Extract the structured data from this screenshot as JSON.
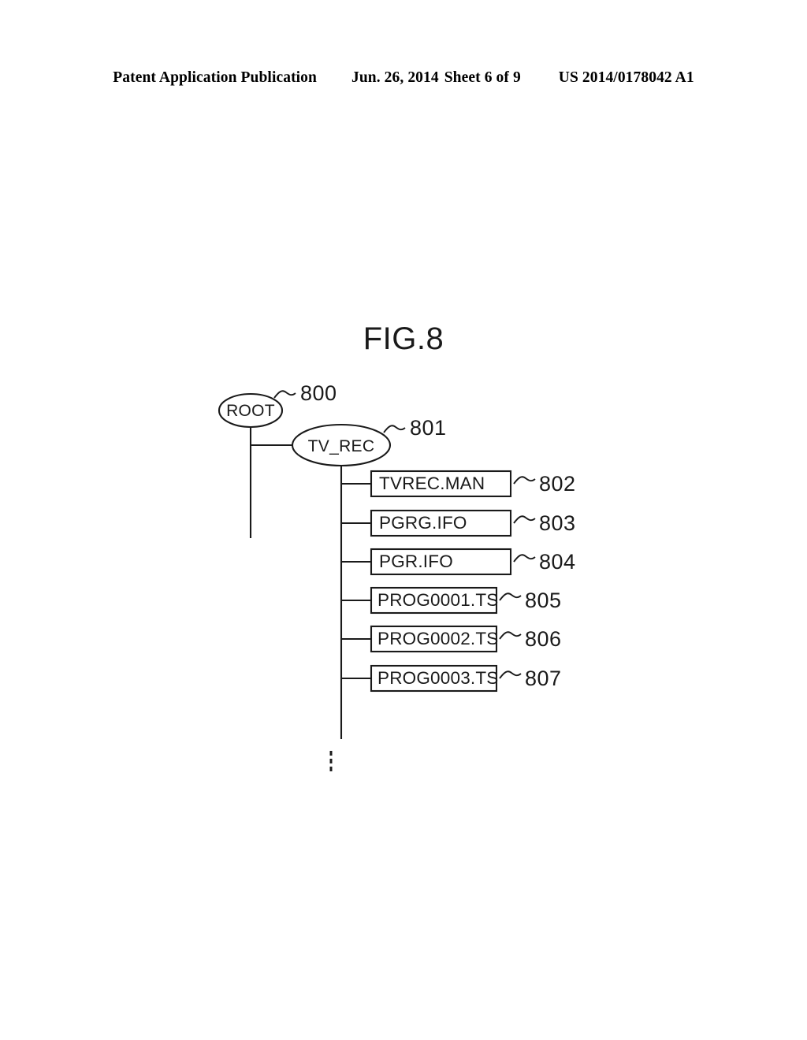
{
  "header": {
    "publication": "Patent Application Publication",
    "date": "Jun. 26, 2014",
    "sheet": "Sheet 6 of 9",
    "document_number": "US 2014/0178042 A1"
  },
  "figure": {
    "title": "FIG.8",
    "nodes": [
      {
        "id": "root",
        "label": "ROOT",
        "ref": "800",
        "shape": "ellipse"
      },
      {
        "id": "tv_rec",
        "label": "TV_REC",
        "ref": "801",
        "shape": "ellipse"
      }
    ],
    "files": [
      {
        "id": "file-802",
        "label": "TVREC.MAN",
        "ref": "802"
      },
      {
        "id": "file-803",
        "label": "PGRG.IFO",
        "ref": "803"
      },
      {
        "id": "file-804",
        "label": "PGR.IFO",
        "ref": "804"
      },
      {
        "id": "file-805",
        "label": "PROG0001.TS",
        "ref": "805"
      },
      {
        "id": "file-806",
        "label": "PROG0002.TS",
        "ref": "806"
      },
      {
        "id": "file-807",
        "label": "PROG0003.TS",
        "ref": "807"
      }
    ],
    "continuation": "vertical-ellipsis",
    "ink_color": "#1a1a1a"
  }
}
